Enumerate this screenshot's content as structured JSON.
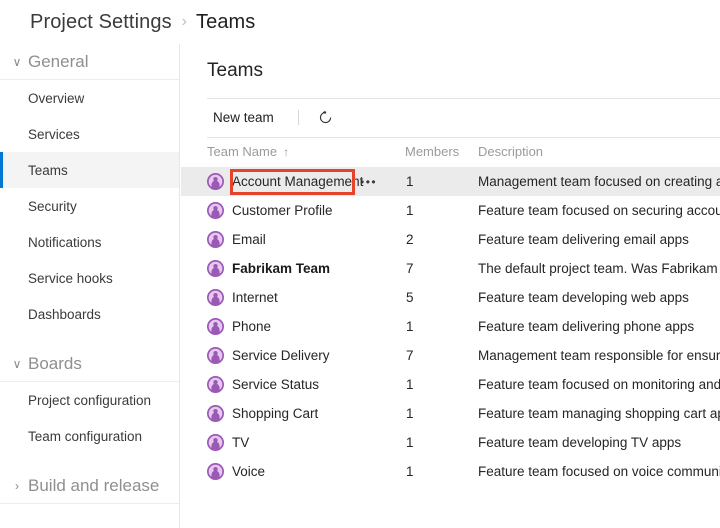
{
  "breadcrumb": {
    "root": "Project Settings",
    "separator": "›",
    "leaf": "Teams"
  },
  "sidebar": {
    "groups": [
      {
        "label": "General",
        "chevron": "∨",
        "expanded": true,
        "items": [
          {
            "label": "Overview",
            "selected": false
          },
          {
            "label": "Services",
            "selected": false
          },
          {
            "label": "Teams",
            "selected": true
          },
          {
            "label": "Security",
            "selected": false
          },
          {
            "label": "Notifications",
            "selected": false
          },
          {
            "label": "Service hooks",
            "selected": false
          },
          {
            "label": "Dashboards",
            "selected": false
          }
        ]
      },
      {
        "label": "Boards",
        "chevron": "∨",
        "expanded": true,
        "items": [
          {
            "label": "Project configuration",
            "selected": false
          },
          {
            "label": "Team configuration",
            "selected": false
          }
        ]
      },
      {
        "label": "Build and release",
        "chevron": "›",
        "expanded": false,
        "items": []
      }
    ]
  },
  "main": {
    "title": "Teams",
    "toolbar": {
      "new_team_label": "New team",
      "refresh_icon": "refresh-icon"
    },
    "grid": {
      "columns": {
        "name": "Team Name",
        "name_sort_arrow": "↑",
        "members": "Members",
        "description": "Description"
      },
      "rows": [
        {
          "name": "Account Management",
          "members": "1",
          "description": "Management team focused on creating an",
          "selected": true,
          "bold": false,
          "show_ellipsis": true,
          "ellipsis": "•••",
          "focused": true
        },
        {
          "name": "Customer Profile",
          "members": "1",
          "description": "Feature team focused on securing account",
          "selected": false,
          "bold": false,
          "show_ellipsis": false,
          "ellipsis": "",
          "focused": false
        },
        {
          "name": "Email",
          "members": "2",
          "description": "Feature team delivering email apps",
          "selected": false,
          "bold": false,
          "show_ellipsis": false,
          "ellipsis": "",
          "focused": false
        },
        {
          "name": "Fabrikam Team",
          "members": "7",
          "description": "The default project team. Was Fabrikam Fi",
          "selected": false,
          "bold": true,
          "show_ellipsis": false,
          "ellipsis": "",
          "focused": false
        },
        {
          "name": "Internet",
          "members": "5",
          "description": "Feature team developing web apps",
          "selected": false,
          "bold": false,
          "show_ellipsis": false,
          "ellipsis": "",
          "focused": false
        },
        {
          "name": "Phone",
          "members": "1",
          "description": "Feature team delivering phone apps",
          "selected": false,
          "bold": false,
          "show_ellipsis": false,
          "ellipsis": "",
          "focused": false
        },
        {
          "name": "Service Delivery",
          "members": "7",
          "description": "Management team responsible for ensure",
          "selected": false,
          "bold": false,
          "show_ellipsis": false,
          "ellipsis": "",
          "focused": false
        },
        {
          "name": "Service Status",
          "members": "1",
          "description": "Feature team focused on monitoring and ",
          "selected": false,
          "bold": false,
          "show_ellipsis": false,
          "ellipsis": "",
          "focused": false
        },
        {
          "name": "Shopping Cart",
          "members": "1",
          "description": "Feature team managing shopping cart app",
          "selected": false,
          "bold": false,
          "show_ellipsis": false,
          "ellipsis": "",
          "focused": false
        },
        {
          "name": "TV",
          "members": "1",
          "description": "Feature team developing TV apps",
          "selected": false,
          "bold": false,
          "show_ellipsis": false,
          "ellipsis": "",
          "focused": false
        },
        {
          "name": "Voice",
          "members": "1",
          "description": "Feature team focused on voice communic",
          "selected": false,
          "bold": false,
          "show_ellipsis": false,
          "ellipsis": "",
          "focused": false
        }
      ]
    }
  },
  "colors": {
    "accent": "#0078d4",
    "team_icon": "#9b59b6",
    "team_icon_fill": "#e5c9ee",
    "focus_outline": "#e8412c",
    "row_selected_bg": "#ebebeb"
  }
}
